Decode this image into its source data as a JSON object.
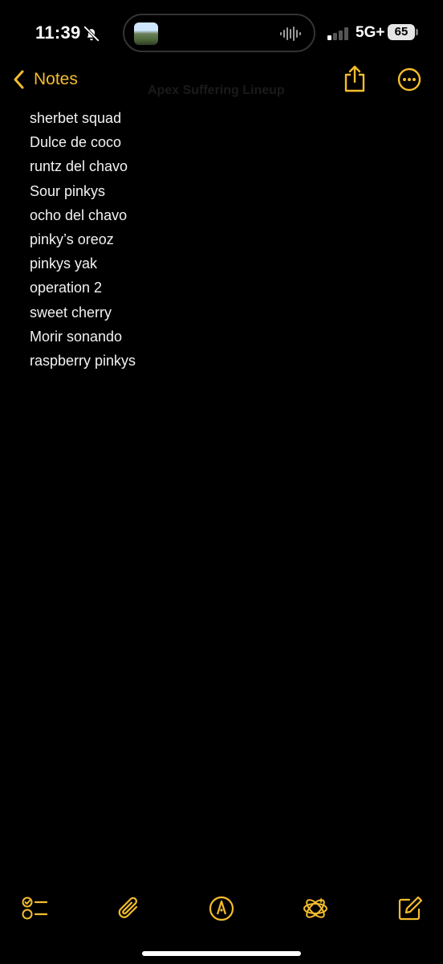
{
  "status_bar": {
    "time": "11:39",
    "network": "5G+",
    "battery": "65",
    "icons": [
      "bell-slash-icon",
      "waveform-icon",
      "signal-icon"
    ]
  },
  "nav": {
    "back_label": "Notes",
    "ghost_title": "Apex Suffering Lineup",
    "share_icon": "share-icon",
    "more_icon": "ellipsis-circle-icon"
  },
  "note": {
    "lines": [
      "sherbet squad",
      "Dulce de coco",
      "runtz del chavo",
      "Sour pinkys",
      "ocho del chavo",
      "pinky’s oreoz",
      "pinkys yak",
      "operation 2",
      "sweet cherry",
      "Morir sonando",
      "raspberry pinkys"
    ]
  },
  "toolbar": {
    "items": [
      "checklist-icon",
      "paperclip-icon",
      "markup-pen-icon",
      "apple-intelligence-icon",
      "compose-icon"
    ]
  },
  "colors": {
    "accent": "#f4bd2d",
    "background": "#000000",
    "text": "#f2f2f2"
  }
}
